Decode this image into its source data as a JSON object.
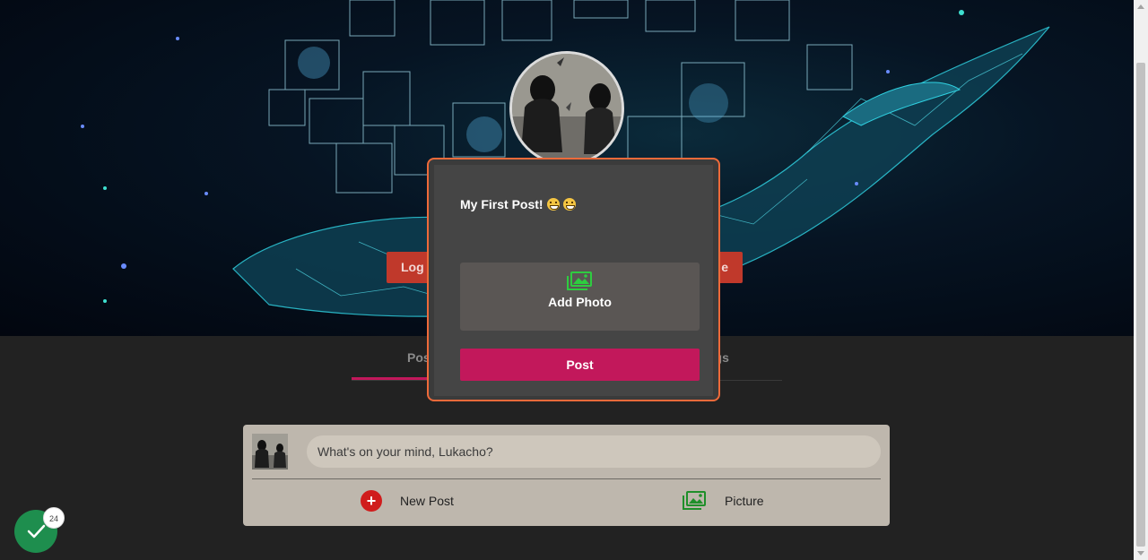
{
  "cover": {
    "logout_label": "Log O",
    "right_button_label": "e"
  },
  "profile": {
    "username": "Lukacho"
  },
  "tabs": [
    {
      "label": "Post"
    },
    {
      "label": "ngs"
    }
  ],
  "composer": {
    "placeholder": "What's on your mind, Lukacho?",
    "new_post_label": "New Post",
    "picture_label": "Picture"
  },
  "modal": {
    "title": "My First Post!",
    "title_emoji": "grinning-face-with-smiling-eyes",
    "add_photo_label": "Add Photo",
    "post_label": "Post"
  },
  "notification": {
    "count": "24"
  },
  "colors": {
    "accent": "#c2185b",
    "modal_border": "#ee6a3a",
    "danger": "#c0392b",
    "success": "#1e8e4e",
    "photo_icon": "#2ecc40"
  }
}
